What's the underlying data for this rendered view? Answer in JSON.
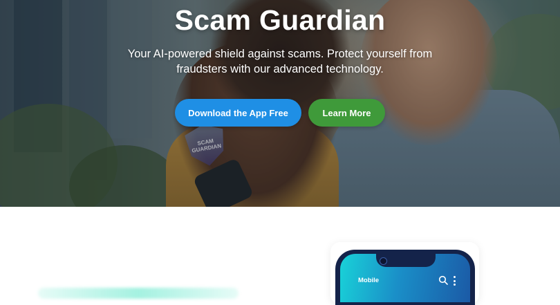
{
  "hero": {
    "title": "Scam Guardian",
    "subtitle": "Your AI-powered shield against scams. Protect yourself from fraudsters with our advanced technology.",
    "badge_text": "SCAM GUARDIAN",
    "buttons": {
      "download_label": "Download the App Free",
      "learn_more_label": "Learn More"
    }
  },
  "phone_mockup": {
    "app_title": "Mobile",
    "icons": [
      "search-icon",
      "more-vertical-icon"
    ]
  },
  "colors": {
    "download_button": "#1f8fe5",
    "learn_more_button": "#3f9a3a",
    "phone_frame": "#14234a",
    "phone_screen_start": "#19d2d8",
    "phone_screen_end": "#1b5aa6"
  }
}
